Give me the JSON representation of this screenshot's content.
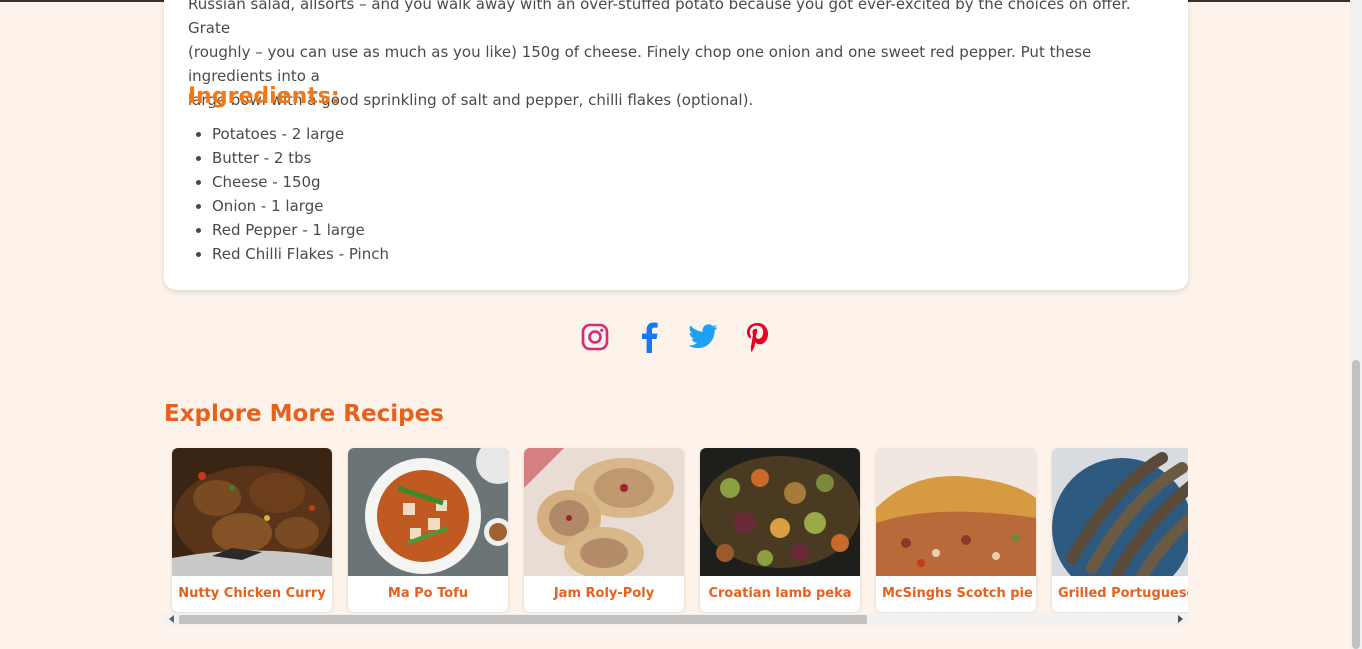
{
  "recipe": {
    "intro_lines": [
      "Russian salad, allsorts – and you walk away with an over-stuffed potato because you got ever-excited by the choices on offer. Grate",
      "(roughly – you can use as much as you like) 150g of cheese. Finely chop one onion and one sweet red pepper. Put these ingredients into a",
      "large bowl with a good sprinkling of salt and pepper, chilli flakes (optional)."
    ],
    "ingredients_title": "Ingredients:",
    "ingredients": [
      "Potatoes - 2 large",
      "Butter - 2 tbs",
      "Cheese - 150g",
      "Onion - 1 large",
      "Red Pepper - 1 large",
      "Red Chilli Flakes - Pinch"
    ]
  },
  "social": [
    {
      "icon": "instagram-icon",
      "color": "#d62976"
    },
    {
      "icon": "facebook-icon",
      "color": "#1877f2"
    },
    {
      "icon": "twitter-icon",
      "color": "#1da1f2"
    },
    {
      "icon": "pinterest-icon",
      "color": "#e60023"
    }
  ],
  "explore": {
    "title": "Explore More Recipes",
    "recipes": [
      {
        "name": "Nutty Chicken Curry"
      },
      {
        "name": "Ma Po Tofu"
      },
      {
        "name": "Jam Roly-Poly"
      },
      {
        "name": "Croatian lamb peka"
      },
      {
        "name": "McSinghs Scotch pie"
      },
      {
        "name": "Grilled Portuguese sardines"
      }
    ]
  },
  "colors": {
    "accent": "#e8601c",
    "heading_orange": "#f07818",
    "background": "#fdf3ea"
  }
}
